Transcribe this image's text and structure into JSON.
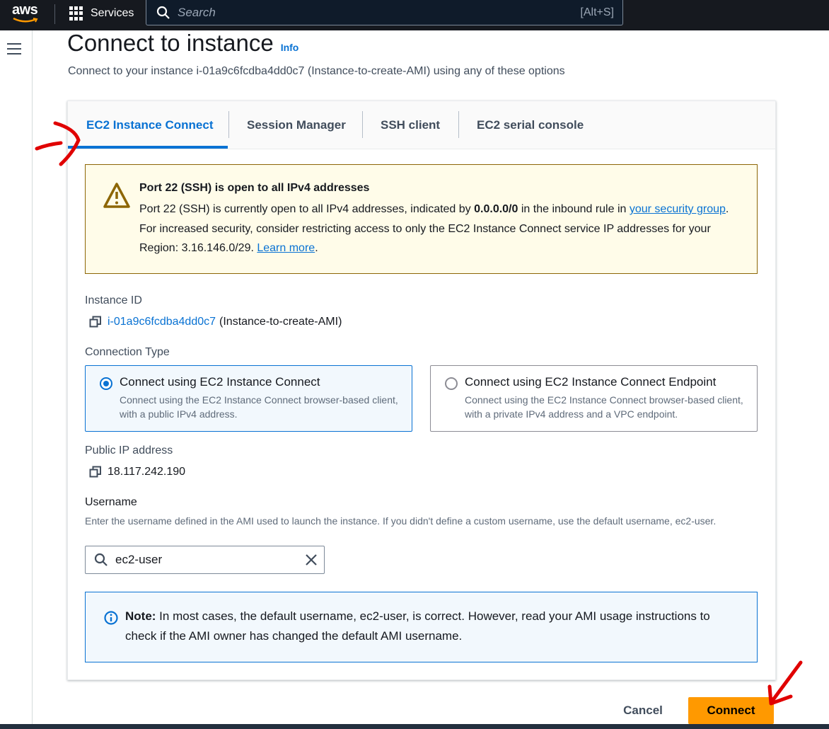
{
  "topnav": {
    "logo_text": "aws",
    "services_label": "Services",
    "search_placeholder": "Search",
    "search_shortcut": "[Alt+S]"
  },
  "header": {
    "title": "Connect to instance",
    "info_link": "Info",
    "description": "Connect to your instance i-01a9c6fcdba4dd0c7 (Instance-to-create-AMI) using any of these options"
  },
  "tabs": [
    {
      "label": "EC2 Instance Connect",
      "active": true
    },
    {
      "label": "Session Manager",
      "active": false
    },
    {
      "label": "SSH client",
      "active": false
    },
    {
      "label": "EC2 serial console",
      "active": false
    }
  ],
  "warning": {
    "title": "Port 22 (SSH) is open to all IPv4 addresses",
    "body_1": "Port 22 (SSH) is currently open to all IPv4 addresses, indicated by ",
    "body_bold": "0.0.0.0/0",
    "body_2": " in the inbound rule in ",
    "link_security_group": "your security group",
    "body_3": ". For increased security, consider restricting access to only the EC2 Instance Connect service IP addresses for your Region: 3.16.146.0/29. ",
    "link_learn_more": "Learn more",
    "body_4": "."
  },
  "instance": {
    "label": "Instance ID",
    "id": "i-01a9c6fcdba4dd0c7",
    "name": "(Instance-to-create-AMI)"
  },
  "connection_type": {
    "label": "Connection Type",
    "options": [
      {
        "title": "Connect using EC2 Instance Connect",
        "description": "Connect using the EC2 Instance Connect browser-based client, with a public IPv4 address.",
        "selected": true
      },
      {
        "title": "Connect using EC2 Instance Connect Endpoint",
        "description": "Connect using the EC2 Instance Connect browser-based client, with a private IPv4 address and a VPC endpoint.",
        "selected": false
      }
    ]
  },
  "public_ip": {
    "label": "Public IP address",
    "value": "18.117.242.190"
  },
  "username": {
    "label": "Username",
    "help": "Enter the username defined in the AMI used to launch the instance. If you didn't define a custom username, use the default username, ec2-user.",
    "value": "ec2-user"
  },
  "note": {
    "bold": "Note:",
    "text": " In most cases, the default username, ec2-user, is correct. However, read your AMI usage instructions to check if the AMI owner has changed the default AMI username."
  },
  "actions": {
    "cancel": "Cancel",
    "connect": "Connect"
  },
  "colors": {
    "accent": "#0972d3",
    "primary_button": "#ff9900",
    "warning_bg": "#fffce9",
    "annotation": "#e00000"
  }
}
